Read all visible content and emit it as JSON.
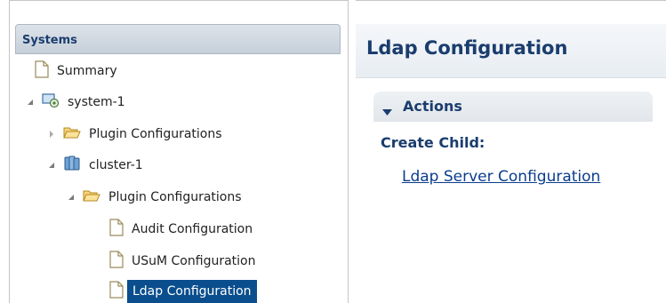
{
  "sidebar": {
    "header": "Systems",
    "tree": [
      {
        "label": "Summary"
      },
      {
        "label": "system-1"
      },
      {
        "label": "Plugin Configurations"
      },
      {
        "label": "cluster-1"
      },
      {
        "label": "Plugin Configurations"
      },
      {
        "label": "Audit Configuration"
      },
      {
        "label": "USuM Configuration"
      },
      {
        "label": "Ldap Configuration",
        "selected": true
      }
    ]
  },
  "main": {
    "title": "Ldap Configuration",
    "actions_label": "Actions",
    "create_child_label": "Create Child:",
    "links": [
      "Ldap Server Configuration"
    ]
  },
  "colors": {
    "header_text": "#1a3d6e",
    "selection": "#0a4e8d",
    "link": "#0b3d8c"
  }
}
